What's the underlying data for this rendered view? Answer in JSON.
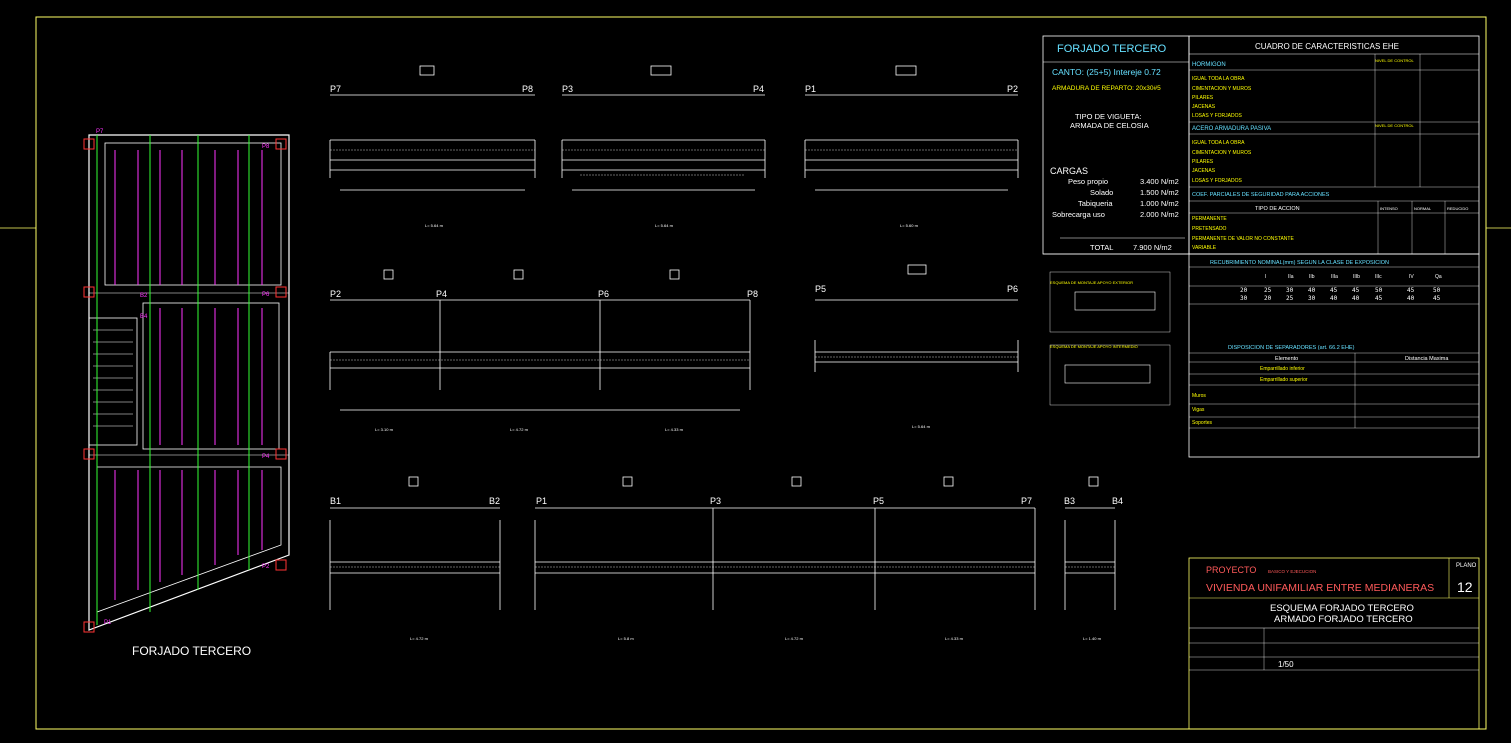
{
  "colors": {
    "background": "#000000",
    "frame": "#ffff66",
    "line": "#ffffff",
    "accent_cyan": "#66e0ff",
    "accent_yellow": "#ffff00",
    "accent_magenta": "#ff33ff",
    "accent_green": "#33ff33",
    "accent_red": "#ff3333",
    "title_red": "#ff5a5a"
  },
  "plan": {
    "title": "FORJADO TERCERO"
  },
  "sections": {
    "top": [
      {
        "left": "P7",
        "right": "P8",
        "length": "L= 5.64 m"
      },
      {
        "left": "P3",
        "right": "P4",
        "length": "L= 5.64 m"
      },
      {
        "left": "P1",
        "right": "P2",
        "length": "L= 5.60 m"
      }
    ],
    "middle_long": {
      "labels": [
        "P2",
        "P4",
        "P6",
        "P8"
      ],
      "lengths": [
        "L= 3.10 m",
        "L= 4.72 m",
        "L= 4.33 m"
      ]
    },
    "middle_short": {
      "left": "P5",
      "right": "P6",
      "length": "L= 5.64 m"
    },
    "bottom": [
      {
        "left": "B1",
        "right": "B2",
        "length": "L= 4.72 m"
      },
      {
        "labels": [
          "P1",
          "P3",
          "P5",
          "P7"
        ],
        "lengths": [
          "L= 5.8 m",
          "L= 4.72 m",
          "L= 4.33 m"
        ]
      },
      {
        "left": "B3",
        "right": "B4",
        "length": "L= 1.40 m"
      }
    ]
  },
  "spec": {
    "title": "FORJADO TERCERO",
    "canto": "CANTO: (25+5) Intereje 0.72",
    "armadura": "ARMADURA DE REPARTO: 20x30#5",
    "tipo_vigueta": [
      "TIPO DE VIGUETA:",
      "ARMADA DE CELOSIA"
    ],
    "cargas_title": "CARGAS",
    "loads": [
      {
        "name": "Peso propio",
        "value": "3.400 N/m2"
      },
      {
        "name": "Solado",
        "value": "1.500 N/m2"
      },
      {
        "name": "Tabiqueria",
        "value": "1.000 N/m2"
      },
      {
        "name": "Sobrecarga uso",
        "value": "2.000 N/m2"
      }
    ],
    "total_label": "TOTAL",
    "total_value": "7.900 N/m2",
    "detail_labels": [
      "ESQUEMA DE MONTAJE APOYO EXTERIOR",
      "ESQUEMA DE MONTAJE APOYO INTERMEDIO"
    ]
  },
  "caract": {
    "title": "CUADRO DE CARACTERISTICAS EHE",
    "hormigon_title": "HORMIGON",
    "nivel_control": "NIVEL DE CONTROL",
    "hormigon_rows": [
      "IGUAL TODA LA OBRA",
      "CIMENTACION Y MUROS",
      "PILARES",
      "JACENAS",
      "LOSAS Y FORJADOS"
    ],
    "acero_title": "ACERO ARMADURA PASIVA",
    "acero_rows": [
      "IGUAL TODA LA OBRA",
      "CIMENTACION Y MUROS",
      "PILARES",
      "JACENAS",
      "LOSAS Y FORJADOS"
    ],
    "coef_title": "COEF. PARCIALES DE SEGURIDAD PARA ACCIONES",
    "tipo_accion": "TIPO DE ACCION",
    "coef_cols": [
      "INTENSO",
      "NORMAL",
      "REDUCIDO"
    ],
    "coef_rows": [
      "PERMANENTE",
      "PRETENSADO",
      "PERMANENTE DE VALOR NO CONSTANTE",
      "VARIABLE"
    ],
    "recub_title": "RECUBRIMIENTO NOMINAL(mm) SEGUN LA CLASE DE EXPOSICION",
    "recub_header": [
      "I",
      "IIa",
      "IIb",
      "IIIa",
      "IIIb",
      "IIIc",
      "IV",
      "Qa"
    ],
    "recub_row1": [
      "20",
      "25",
      "30",
      "40",
      "45",
      "45",
      "50",
      "45",
      "50"
    ],
    "recub_row2": [
      "30",
      "20",
      "25",
      "30",
      "40",
      "40",
      "45",
      "40",
      "45"
    ],
    "sep_title": "DISPOSICION DE SEPARADORES (art. 66.2 EHE)",
    "sep_cols": [
      "Elemento",
      "Distancia Maxima"
    ],
    "sep_rows": [
      "Emparrillado inferior",
      "Emparrillado superior",
      "Muros",
      "Vigas",
      "Soportes"
    ]
  },
  "title_block": {
    "proyecto_label": "PROYECTO",
    "proyecto_sub": "BASICO Y EJECUCION",
    "proyecto_name": "VIVIENDA UNIFAMILIAR ENTRE MEDIANERAS",
    "plano_label": "PLANO",
    "plano_number": "12",
    "description": [
      "ESQUEMA FORJADO TERCERO",
      "ARMADO FORJADO TERCERO"
    ],
    "escala": "1/50"
  }
}
